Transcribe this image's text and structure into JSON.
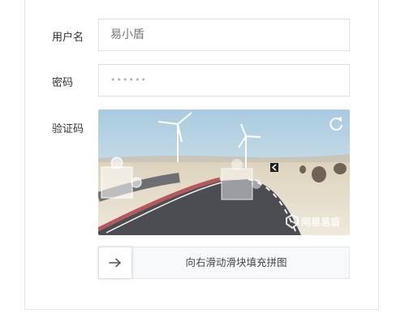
{
  "form": {
    "username": {
      "label": "用户名",
      "placeholder": "易小盾"
    },
    "password": {
      "label": "密码",
      "value": "••••••"
    },
    "captcha": {
      "label": "验证码",
      "watermark": "网易易盾",
      "refresh_icon": "refresh-icon",
      "slider_hint": "向右滑动滑块填充拼图",
      "slider_icon": "arrow-right-icon"
    }
  },
  "colors": {
    "border": "#dcdfe6",
    "slider_bg": "#f7f9fa",
    "text": "#333333",
    "placeholder": "#b4b4b4"
  }
}
